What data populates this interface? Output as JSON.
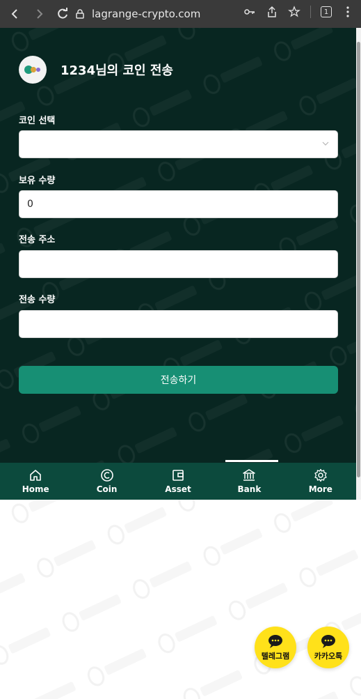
{
  "browser": {
    "url": "lagrange-crypto.com",
    "tab_count": "1"
  },
  "page": {
    "title": "1234님의 코인 전송"
  },
  "form": {
    "coin_select_label": "코인 선택",
    "coin_select_value": "",
    "balance_label": "보유 수량",
    "balance_value": "0",
    "address_label": "전송 주소",
    "address_value": "",
    "amount_label": "전송 수량",
    "amount_value": "",
    "submit_label": "전송하기"
  },
  "bottom_nav": {
    "items": [
      {
        "label": "Home",
        "icon": "home-icon"
      },
      {
        "label": "Coin",
        "icon": "coin-icon"
      },
      {
        "label": "Asset",
        "icon": "wallet-icon"
      },
      {
        "label": "Bank",
        "icon": "bank-icon"
      },
      {
        "label": "More",
        "icon": "gear-icon"
      }
    ],
    "active": "Bank"
  },
  "floating": {
    "telegram_label": "텔레그램",
    "kakao_label": "카카오톡"
  },
  "watermark": {
    "text": "담덕 법률사무소"
  },
  "colors": {
    "app_bg": "#082621",
    "nav_bg": "#0c4a3d",
    "accent": "#178f74",
    "fab_bg": "#ffe11a"
  }
}
